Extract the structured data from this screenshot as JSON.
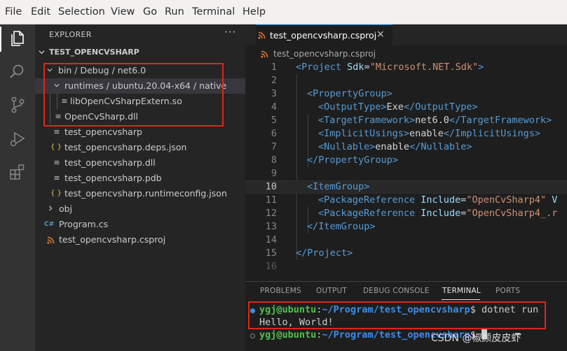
{
  "menu": [
    "File",
    "Edit",
    "Selection",
    "View",
    "Go",
    "Run",
    "Terminal",
    "Help"
  ],
  "activity_bar": {
    "items": [
      "explorer-icon",
      "search-icon",
      "source-control-icon",
      "run-debug-icon",
      "extensions-icon"
    ],
    "active": "explorer-icon"
  },
  "explorer": {
    "title": "EXPLORER",
    "more": "···",
    "folder_name": "TEST_OPENCVSHARP",
    "tree": {
      "bin_debug_net": "bin / Debug / net6.0",
      "runtimes_path": "runtimes / ubuntu.20.04-x64 / native",
      "lib_so": "libOpenCvSharpExtern.so",
      "opencv_dll": "OpenCvSharp.dll",
      "exe": "test_opencvsharp",
      "deps_json": "test_opencvsharp.deps.json",
      "dll": "test_opencvsharp.dll",
      "pdb": "test_opencvsharp.pdb",
      "runtimeconfig": "test_opencvsharp.runtimeconfig.json",
      "obj": "obj",
      "program_cs": "Program.cs",
      "csproj": "test_opencvsharp.csproj"
    },
    "json_glyph": "{ }",
    "cs_glyph": "C#"
  },
  "editor": {
    "tab_label": "test_opencvsharp.csproj",
    "tab_close": "×",
    "breadcrumb": "test_opencvsharp.csproj",
    "active_line": 10,
    "line_numbers": [
      "1",
      "2",
      "3",
      "4",
      "5",
      "6",
      "7",
      "8",
      "9",
      "10",
      "11",
      "12",
      "13",
      "14",
      "15",
      "16"
    ],
    "code": {
      "l1_open": "<Project",
      "l1_attr": " Sdk",
      "l1_eq": "=",
      "l1_val": "\"Microsoft.NET.Sdk\"",
      "l1_close": ">",
      "l3": "<PropertyGroup>",
      "l4_open": "<OutputType>",
      "l4_val": "Exe",
      "l4_close": "</OutputType>",
      "l5_open": "<TargetFramework>",
      "l5_val": "net6.0",
      "l5_close": "</TargetFramework>",
      "l6_open": "<ImplicitUsings>",
      "l6_val": "enable",
      "l6_close": "</ImplicitUsings>",
      "l7_open": "<Nullable>",
      "l7_val": "enable",
      "l7_close": "</Nullable>",
      "l8": "</PropertyGroup>",
      "l10": "<ItemGroup>",
      "l11_open": "<PackageReference",
      "l11_attr": " Include",
      "l11_eq": "=",
      "l11_val": "\"OpenCvSharp4\"",
      "l11_rest": " V",
      "l12_open": "<PackageReference",
      "l12_attr": " Include",
      "l12_eq": "=",
      "l12_val": "\"OpenCvSharp4_.r",
      "l13": "</ItemGroup>",
      "l15": "</Project>"
    }
  },
  "panel": {
    "tabs": [
      "PROBLEMS",
      "OUTPUT",
      "DEBUG CONSOLE",
      "TERMINAL",
      "PORTS"
    ],
    "active_tab": "TERMINAL",
    "terminal": {
      "user": "ygj@ubuntu",
      "sep": ":",
      "path": "~/Program/test_opencvsharp",
      "prompt": "$",
      "command": " dotnet run",
      "output": "Hello, World!",
      "line3_path": "~/Program/test_opencvsharp",
      "line3_prompt": "$ "
    }
  },
  "watermark": "CSDN @椒颜皮皮虾໊",
  "colors": {
    "highlight_box": "#e1251b",
    "tag": "#569cd6",
    "attribute": "#9cdcfe",
    "string": "#ce9178",
    "terminal_user": "#4ec24e",
    "terminal_path": "#3b8eea"
  }
}
